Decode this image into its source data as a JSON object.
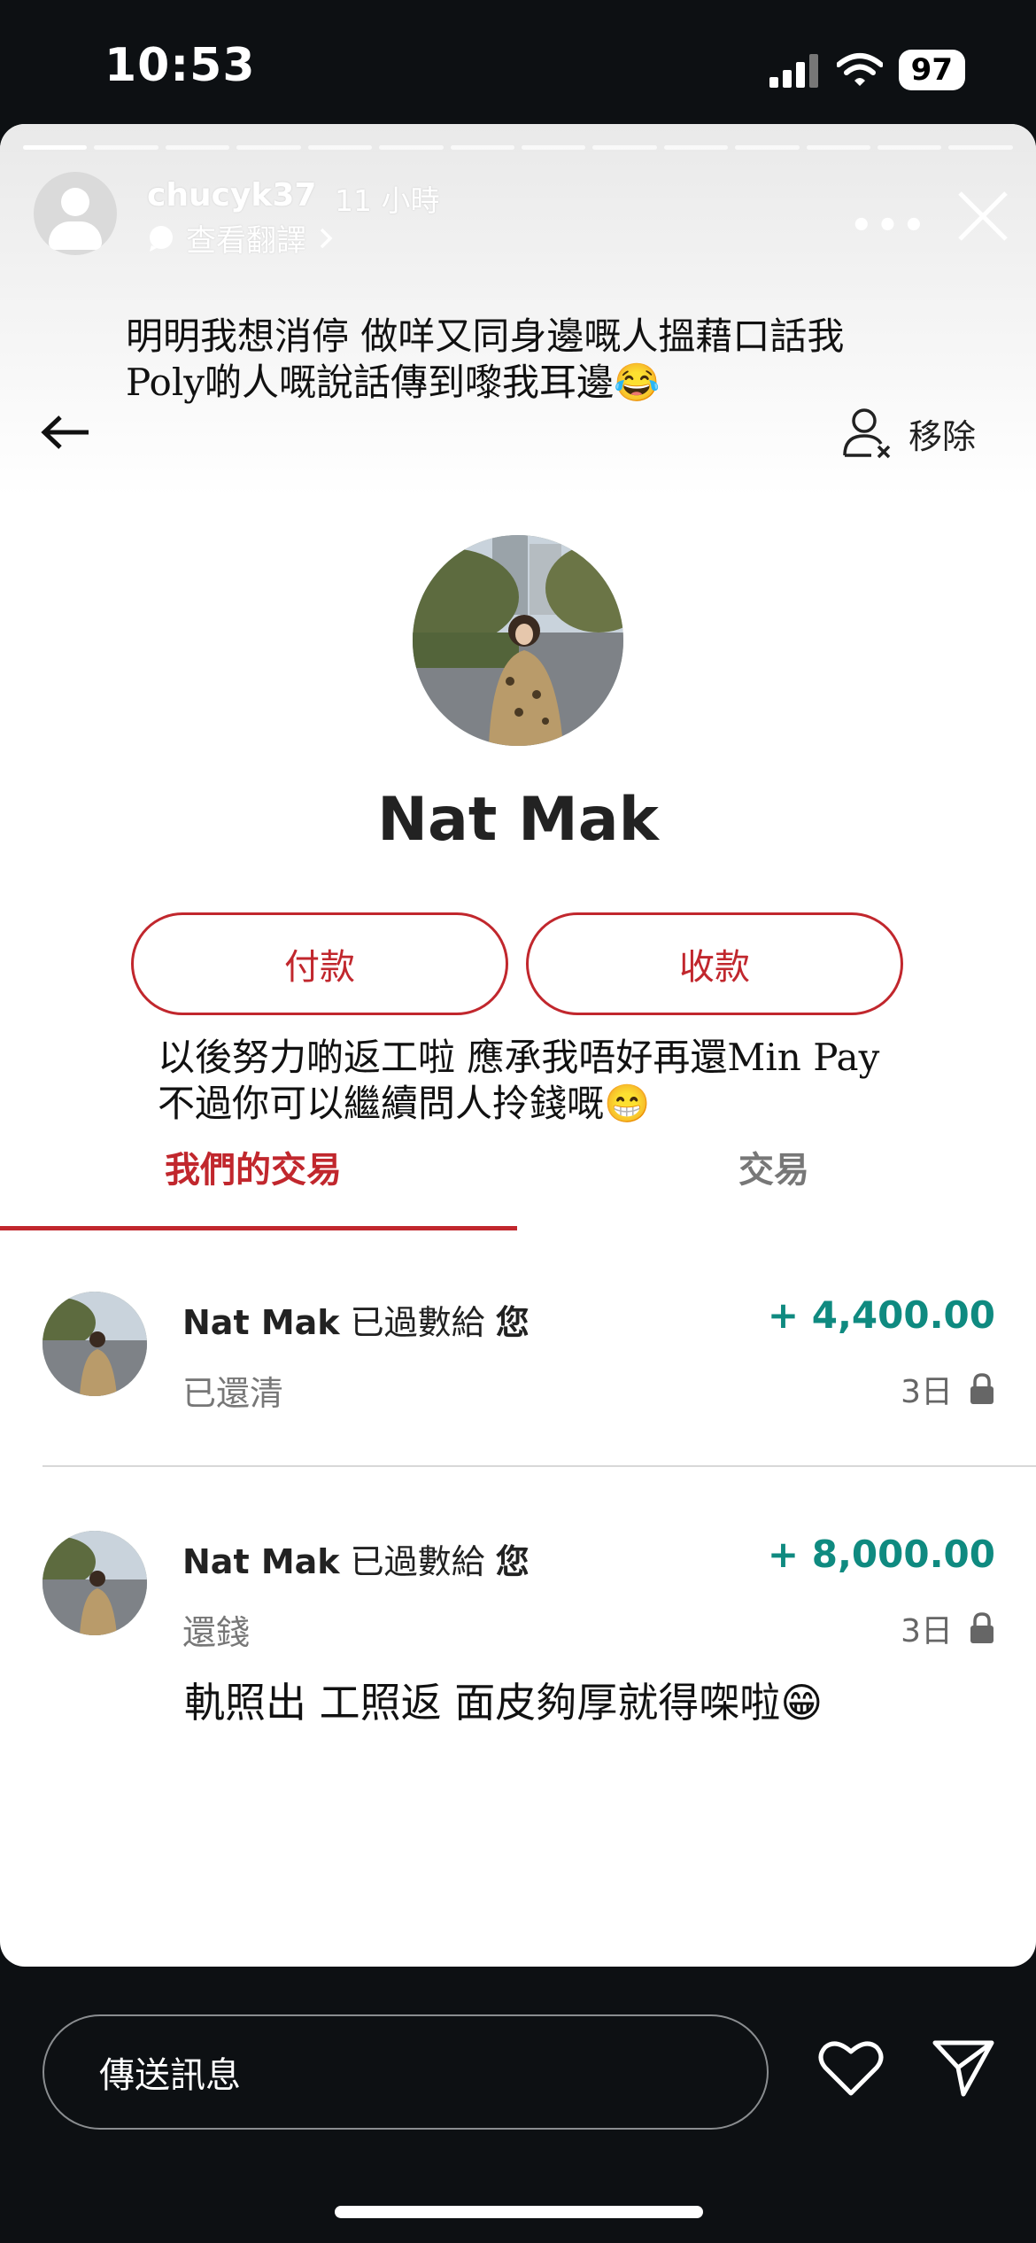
{
  "status_bar": {
    "time": "10:53",
    "battery": "97"
  },
  "story": {
    "username": "chucyk37",
    "time_ago": "11 小時",
    "translate_label": "查看翻譯",
    "caption_line1": "明明我想消停 做咩又同身邊嘅人搵藉口話我",
    "caption_line2": "Poly啲人嘅說話傳到嚟我耳邊😂",
    "caption2_line1": "以後努力啲返工啦 應承我唔好再還Min Pay",
    "caption2_line2": "不過你可以繼續問人拎錢嘅😁"
  },
  "app": {
    "remove_label": "移除",
    "profile_name": "Nat Mak",
    "pay_button": "付款",
    "receive_button": "收款",
    "tabs": [
      "我們的交易",
      "交易"
    ],
    "transactions": [
      {
        "name": "Nat Mak",
        "verb": "已過數給",
        "target": "您",
        "amount": "+ 4,400.00",
        "status": "已還清",
        "date": "3日"
      },
      {
        "name": "Nat Mak",
        "verb": "已過數給",
        "target": "您",
        "amount": "+ 8,000.00",
        "status": "還錢",
        "date": "3日"
      }
    ],
    "note_text": "軌照出 工照返 面皮夠厚就得㗎啦😁"
  },
  "bottom_bar": {
    "message_placeholder": "傳送訊息"
  }
}
